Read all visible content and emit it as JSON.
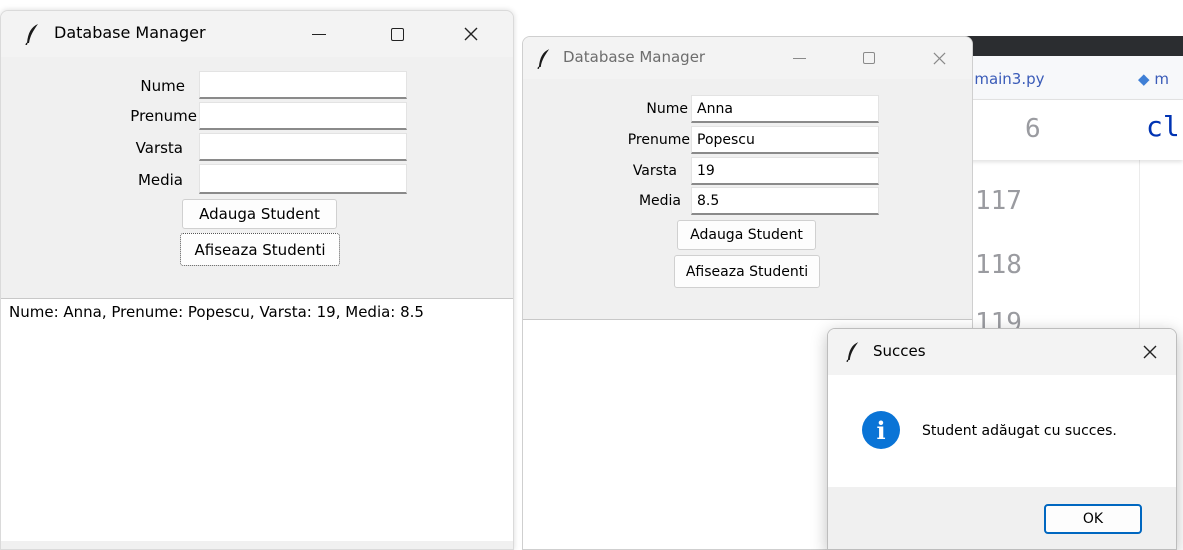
{
  "window1": {
    "title": "Database Manager",
    "labels": {
      "nume": "Nume",
      "prenume": "Prenume",
      "varsta": "Varsta",
      "media": "Media"
    },
    "values": {
      "nume": "",
      "prenume": "",
      "varsta": "",
      "media": ""
    },
    "buttons": {
      "add": "Adauga Student",
      "show": "Afiseaza Studenti"
    },
    "list_items": [
      "Nume: Anna, Prenume: Popescu, Varsta: 19, Media: 8.5"
    ]
  },
  "window2": {
    "title": "Database Manager",
    "labels": {
      "nume": "Nume",
      "prenume": "Prenume",
      "varsta": "Varsta",
      "media": "Media"
    },
    "values": {
      "nume": "Anna",
      "prenume": "Popescu",
      "varsta": "19",
      "media": "8.5"
    },
    "buttons": {
      "add": "Adauga Student",
      "show": "Afiseaza Studenti"
    }
  },
  "editor": {
    "tabs": [
      "main3.py",
      "m"
    ],
    "line_numbers": [
      "6",
      "117",
      "118",
      "119"
    ],
    "code_fragment": "cl"
  },
  "message_box": {
    "title": "Succes",
    "message": "Student adăugat cu succes.",
    "ok_label": "OK",
    "icon": "info-icon"
  },
  "colors": {
    "window_bg": "#f0f0f0",
    "accent": "#0067c0",
    "info_icon": "#0a74d6",
    "editor_keyword": "#0033b3"
  }
}
